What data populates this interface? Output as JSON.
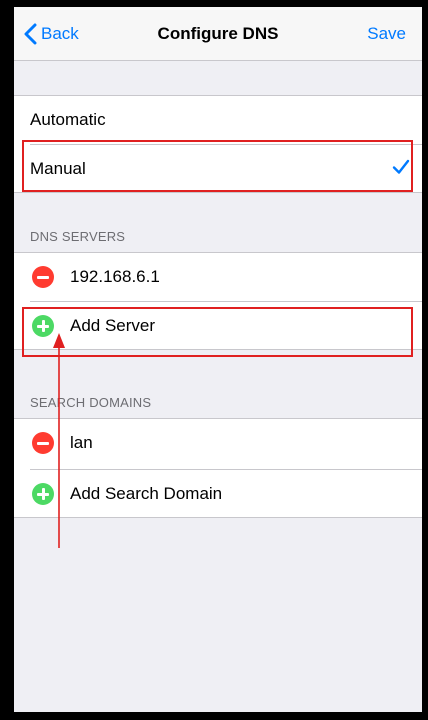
{
  "navbar": {
    "back_label": "Back",
    "title": "Configure DNS",
    "save_label": "Save"
  },
  "mode_options": [
    {
      "label": "Automatic",
      "selected": false
    },
    {
      "label": "Manual",
      "selected": true
    }
  ],
  "dns_servers": {
    "header": "DNS SERVERS",
    "items": [
      "192.168.6.1"
    ],
    "add_label": "Add Server"
  },
  "search_domains": {
    "header": "SEARCH DOMAINS",
    "items": [
      "lan"
    ],
    "add_label": "Add Search Domain"
  },
  "colors": {
    "accent": "#007aff",
    "delete": "#ff3b30",
    "add": "#4cd964",
    "annotation": "#e02020"
  },
  "icons": [
    "chevron-left-icon",
    "checkmark-icon",
    "minus-circle-icon",
    "plus-circle-icon",
    "annotation-arrow"
  ]
}
